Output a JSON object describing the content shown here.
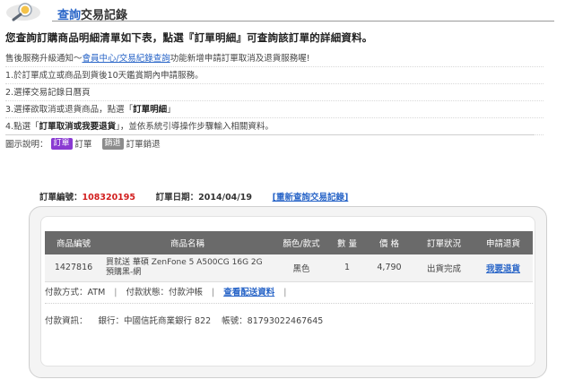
{
  "header": {
    "title_blue": "查詢",
    "title_dark": "交易記錄"
  },
  "intro": "您查詢訂購商品明細清單如下表，點選『訂單明細』可查詢該訂單的詳細資料。",
  "steps": {
    "s0a": "售後服務升級通知～",
    "s0link": "會員中心/交易紀錄查詢",
    "s0b": "功能新增申請訂單取消及退貨服務喔!",
    "s1": "1.於訂單成立或商品到貨後10天鑑賞期內申請服務。",
    "s2": "2.選擇交易記錄日曆頁",
    "s3a": "3.選擇欲取消或退貨商品，點選「",
    "s3b": "訂單明細",
    "s3c": "」",
    "s4a": "4.點選「",
    "s4b": "訂單取消或我要退貨",
    "s4c": "」，並依系統引導操作步驟輸入相關資料。"
  },
  "legend": {
    "prefix": "圖示說明：",
    "order_badge": "訂單",
    "order_label": "訂單",
    "return_badge": "銷退",
    "return_label": "訂單銷退"
  },
  "order": {
    "number_label": "訂單編號：",
    "number": "108320195",
    "date_label": "訂單日期：",
    "date": "2014/04/19",
    "requery": "[重新查詢交易記錄]"
  },
  "table": {
    "headers": [
      "商品編號",
      "商品名稱",
      "顏色/款式",
      "數 量",
      "價 格",
      "訂單狀況",
      "申請退貨"
    ],
    "row": {
      "id": "1427816",
      "name_line1": "買就送 華碩 ZenFone 5 A500CG 16G 2G",
      "name_line2": "預購黑-網",
      "color": "黑色",
      "qty": "1",
      "price": "4,790",
      "status": "出貨完成",
      "apply": "我要退貨"
    }
  },
  "payment": {
    "method": "付款方式：ATM",
    "sep": "|",
    "status": "付款狀態：付款沖帳",
    "view_delivery": "查看配送資料",
    "info_label": "付款資訊：",
    "bank": "銀行：中國信託商業銀行 822",
    "account": "帳號：81793022467645"
  }
}
